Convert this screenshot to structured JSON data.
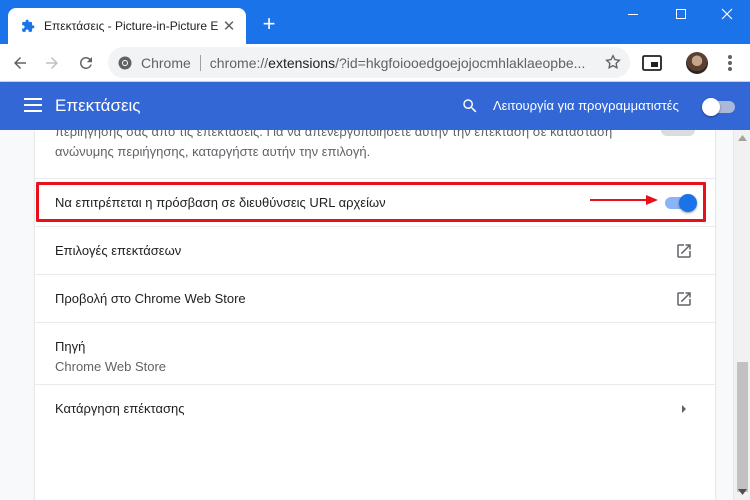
{
  "tab": {
    "title": "Επεκτάσεις - Picture-in-Picture E",
    "favicon": "puzzle-piece-icon",
    "close_label": "✕"
  },
  "newtab_label": "+",
  "window_controls": {
    "minimize": "minimize-icon",
    "maximize": "maximize-icon",
    "close": "close-icon"
  },
  "omnibox": {
    "chip_label": "Chrome",
    "url_prefix": "chrome://",
    "url_host": "extensions",
    "url_rest": "/?id=hkgfoiooedgoejojocmhlaklaeopbe..."
  },
  "header": {
    "title": "Επεκτάσεις",
    "dev_mode_label": "Λειτουργία για προγραμματιστές",
    "dev_mode_on": false
  },
  "details": {
    "clipped_line_1": "περιήγησής σας από τις επεκτάσεις. Για να απενεργοποιήσετε αυτήν την επέκταση σε κατάσταση",
    "clipped_line_2": "ανώνυμης περιήγησης, καταργήστε αυτήν την επιλογή.",
    "file_access_label": "Να επιτρέπεται η πρόσβαση σε διευθύνσεις URL αρχείων",
    "file_access_on": true,
    "extension_options_label": "Επιλογές επεκτάσεων",
    "web_store_label": "Προβολή στο Chrome Web Store",
    "source_label": "Πηγή",
    "source_value": "Chrome Web Store",
    "remove_label": "Κατάργηση επέκτασης"
  },
  "colors": {
    "chrome_blue": "#1a73e8",
    "header_blue": "#3367d6",
    "highlight_red": "#e8111a",
    "toggle_on": "#1a73e8"
  }
}
